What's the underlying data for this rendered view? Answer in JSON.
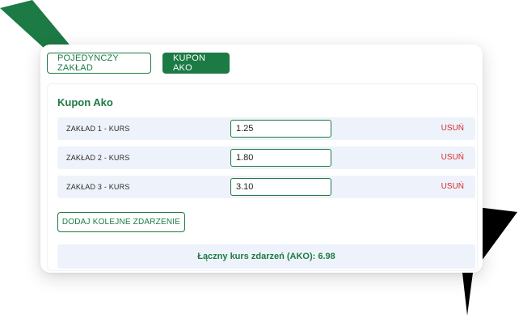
{
  "tabs": {
    "single_label": "POJEDYNCZY ZAKŁAD",
    "ako_label": "KUPON AKO"
  },
  "coupon": {
    "title": "Kupon Ako",
    "bets": [
      {
        "label": "ZAKŁAD 1 - KURS",
        "value": "1.25",
        "remove_label": "USUŃ"
      },
      {
        "label": "ZAKŁAD 2 - KURS",
        "value": "1.80",
        "remove_label": "USUŃ"
      },
      {
        "label": "ZAKŁAD 3 - KURS",
        "value": "3.10",
        "remove_label": "USUŃ"
      }
    ],
    "add_button_label": "DODAJ KOLEJNE ZDARZENIE",
    "total_label": "Łączny kurs zdarzeń (AKO): 6.98"
  },
  "colors": {
    "accent": "#1c7a44",
    "danger": "#d92a2a",
    "row_bg": "#eef3fb",
    "deco_green": "#1c7a44",
    "deco_black": "#000000"
  }
}
